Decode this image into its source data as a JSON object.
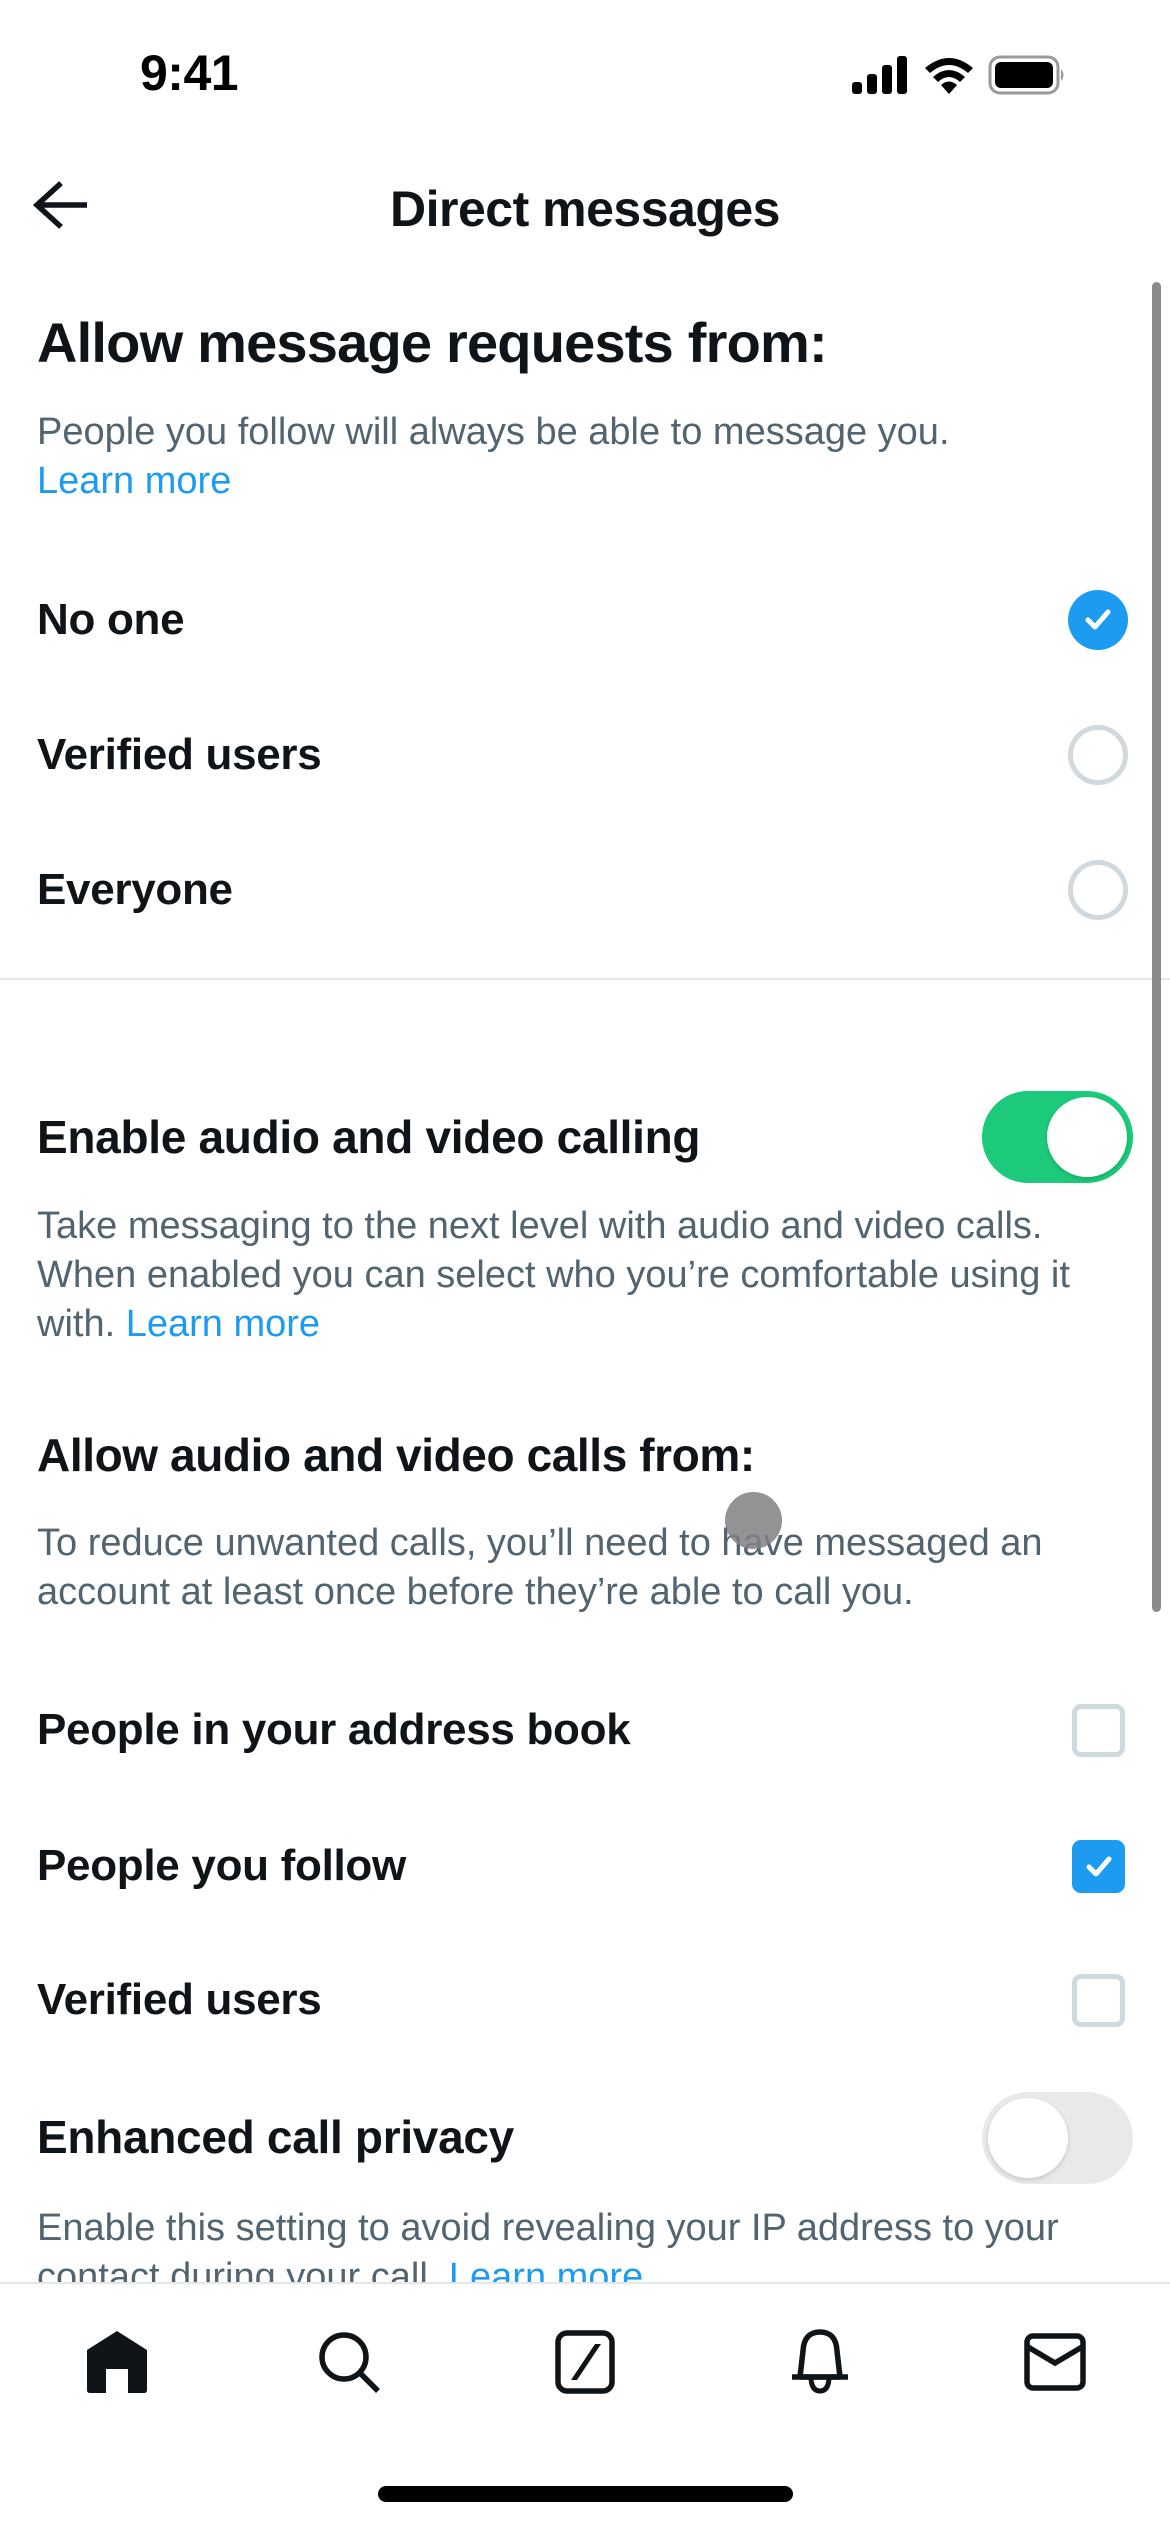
{
  "status_bar": {
    "time": "9:41",
    "icons": [
      "cellular-signal-icon",
      "wifi-icon",
      "battery-icon"
    ]
  },
  "header": {
    "back_icon": "arrow-left-icon",
    "title": "Direct messages"
  },
  "message_requests": {
    "heading": "Allow message requests from:",
    "description": "People you follow will always be able to message you.",
    "learn_more": "Learn more",
    "options": [
      {
        "label": "No one",
        "selected": true
      },
      {
        "label": "Verified users",
        "selected": false
      },
      {
        "label": "Everyone",
        "selected": false
      }
    ]
  },
  "calling": {
    "toggle_label": "Enable audio and video calling",
    "toggle_on": true,
    "description": "Take messaging to the next level with audio and video calls. When enabled you can select who you’re comfortable using it with.",
    "learn_more": "Learn more",
    "calls_from_heading": "Allow audio and video calls from:",
    "calls_from_description": "To reduce unwanted calls, you’ll need to have messaged an account at least once before they’re able to call you.",
    "options": [
      {
        "label": "People in your address book",
        "checked": false
      },
      {
        "label": "People you follow",
        "checked": true
      },
      {
        "label": "Verified users",
        "checked": false
      }
    ]
  },
  "call_privacy": {
    "toggle_label": "Enhanced call privacy",
    "toggle_on": false,
    "description": "Enable this setting to avoid revealing your IP address to your contact during your call.",
    "learn_more": "Learn more"
  },
  "tab_bar": {
    "tabs": [
      {
        "name": "home",
        "icon": "home-icon",
        "active": true
      },
      {
        "name": "search",
        "icon": "search-icon",
        "active": false
      },
      {
        "name": "grok",
        "icon": "grok-icon",
        "active": false
      },
      {
        "name": "notifications",
        "icon": "bell-icon",
        "active": false
      },
      {
        "name": "messages",
        "icon": "mail-icon",
        "active": false
      }
    ]
  },
  "colors": {
    "accent": "#1d9bf0",
    "toggle_on": "#1dc97a",
    "toggle_off": "#e9e9eb",
    "secondary_text": "#536471",
    "primary_text": "#0f1419"
  }
}
